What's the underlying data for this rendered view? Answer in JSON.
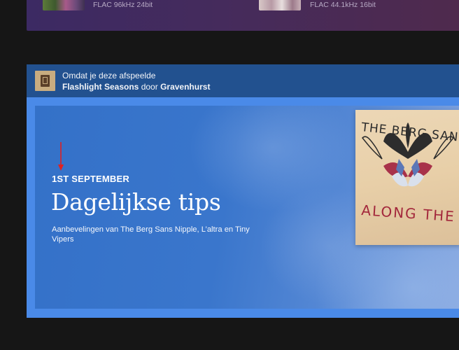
{
  "previous_card": {
    "items": [
      {
        "quality": "FLAC 96kHz 24bit"
      },
      {
        "quality": "FLAC 44.1kHz 16bit"
      }
    ]
  },
  "recommendation": {
    "intro": "Omdat je deze afspeelde",
    "album": "Flashlight Seasons",
    "connector": "door",
    "artist": "Gravenhurst"
  },
  "banner": {
    "eyebrow": "1ST SEPTEMBER",
    "title": "Dagelijkse tips",
    "description": "Aanbevelingen van The Berg Sans Nipple, L’altra en Tiny Vipers",
    "album_art_text_top": "THE BERG SANS NI",
    "album_art_text_bottom": "ALONG THE QUA"
  },
  "colors": {
    "page_background": "#161616",
    "header_background": "#22518f",
    "container_accent": "#4a8ae8",
    "banner_blue": "#3a76cc",
    "annotation_arrow": "#e02020"
  }
}
